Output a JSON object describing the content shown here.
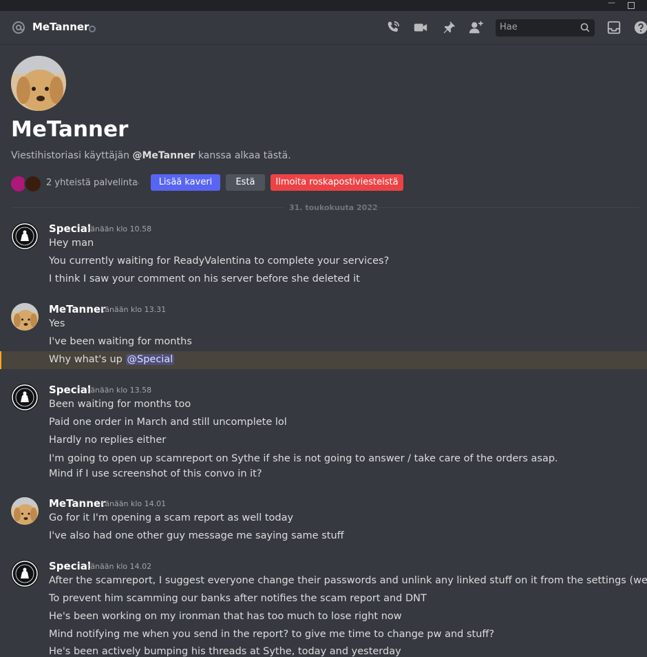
{
  "window": {
    "min_glyph": "—",
    "max_glyph": ""
  },
  "header": {
    "name": "MeTanner",
    "search_placeholder": "Hae",
    "icons": [
      "voice-call-icon",
      "video-call-icon",
      "pin-icon",
      "add-friend-icon",
      "search-icon",
      "inbox-icon",
      "help-icon"
    ]
  },
  "intro": {
    "name": "MeTanner",
    "sub_prefix": "Viestihistoriasi käyttäjän ",
    "sub_user": "@MeTanner",
    "sub_suffix": " kanssa alkaa tästä.",
    "mutual_servers": "2 yhteistä palvelinta",
    "add_friend": "Lisää kaveri",
    "block": "Estä",
    "report": "Ilmoita roskapostiviesteistä"
  },
  "divider_date": "31. toukokuuta 2022",
  "colors": {
    "bg": "#36393f",
    "accent": "#5865f2",
    "danger": "#ed4245",
    "highlight": "#faa81a"
  },
  "groups": [
    {
      "author": "Special",
      "time": "tänään klo 10.58",
      "lines": [
        "Hey man",
        "You currently waiting for ReadyValentina to complete your services?",
        "I think I saw your comment on his server before she deleted it"
      ]
    },
    {
      "author": "MeTanner",
      "time": "tänään klo 13.31",
      "lines": [
        "Yes",
        "I've been waiting for months",
        "Why what's up "
      ],
      "mention": "@Special"
    },
    {
      "author": "Special",
      "time": "tänään klo 13.58",
      "lines": [
        "Been waiting for months too",
        "Paid one order in March and still uncomplete lol",
        "Hardly no replies either",
        "I'm going to open up scamreport on Sythe if she is not going to answer / take care of the orders asap. Mind if I use screenshot of this convo in it?"
      ]
    },
    {
      "author": "MeTanner",
      "time": "tänään klo 14.01",
      "lines": [
        "Go for it I'm opening a scam report as well today",
        "I've also had one other guy message me saying same stuff"
      ]
    },
    {
      "author": "Special",
      "time": "tänään klo 14.02",
      "lines": [
        "After the scamreport, I suggest everyone change their passwords and unlink any linked stuff on it from the settings (website)",
        "To prevent him scamming our banks after notifies the scam report and DNT",
        "He's been working on my ironman that has too much to lose right now",
        "Mind notifying me when you send in the report? to give me time to change pw and stuff?",
        "He's been actively bumping his threads at Sythe, today and yesterday"
      ]
    }
  ]
}
